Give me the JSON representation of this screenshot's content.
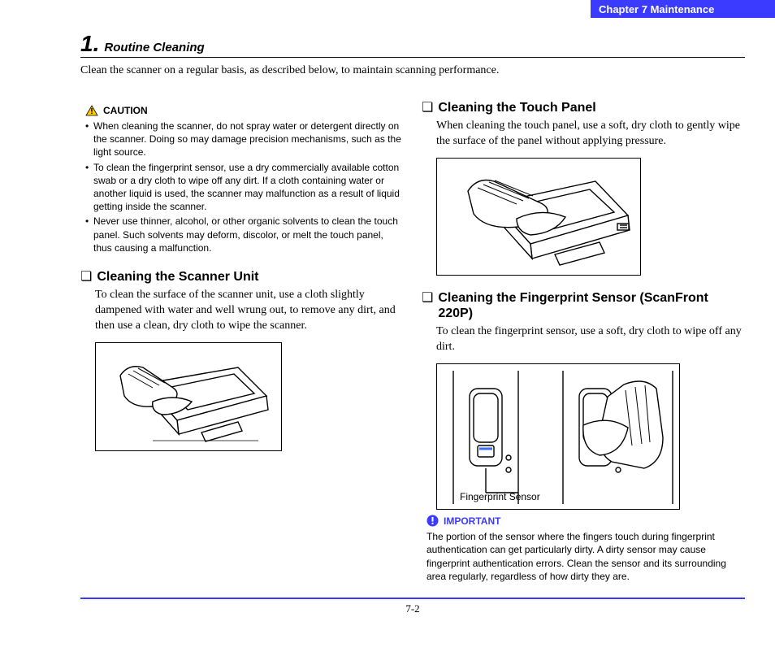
{
  "header": {
    "chapter": "Chapter 7    Maintenance"
  },
  "section": {
    "number": "1.",
    "title": "Routine Cleaning",
    "intro": "Clean the scanner on a regular basis, as described below, to maintain scanning performance."
  },
  "caution": {
    "label": "CAUTION",
    "items": [
      "When cleaning the scanner, do not spray water or detergent directly on the scanner. Doing so may damage precision mechanisms, such as the light source.",
      "To clean the fingerprint sensor, use a dry commercially available cotton swab or a dry cloth to wipe off any dirt. If a cloth containing water or another liquid is used, the scanner may malfunction as a result of liquid getting inside the scanner.",
      "Never use thinner, alcohol, or other organic solvents to clean the touch panel. Such solvents may deform, discolor, or melt the touch panel, thus causing a malfunction."
    ]
  },
  "left": {
    "scannerUnit": {
      "title": "Cleaning the Scanner Unit",
      "body": "To clean the surface of the scanner unit, use a cloth slightly dampened with water and well wrung out, to remove any dirt, and then use a clean, dry cloth to wipe the scanner."
    }
  },
  "right": {
    "touchPanel": {
      "title": "Cleaning the Touch Panel",
      "body": "When cleaning the touch panel, use a soft, dry cloth to gently wipe the surface of the panel without applying pressure."
    },
    "fingerprint": {
      "title": "Cleaning the Fingerprint Sensor (ScanFront 220P)",
      "body": "To clean the fingerprint sensor, use a soft, dry cloth to wipe off any dirt.",
      "figLabel": "Fingerprint Sensor"
    }
  },
  "important": {
    "label": "IMPORTANT",
    "body": "The portion of the sensor where the fingers touch during fingerprint authentication can get particularly dirty. A dirty sensor may cause fingerprint authentication errors. Clean the sensor and its surrounding area regularly, regardless of how dirty they are."
  },
  "footer": {
    "page": "7-2"
  }
}
